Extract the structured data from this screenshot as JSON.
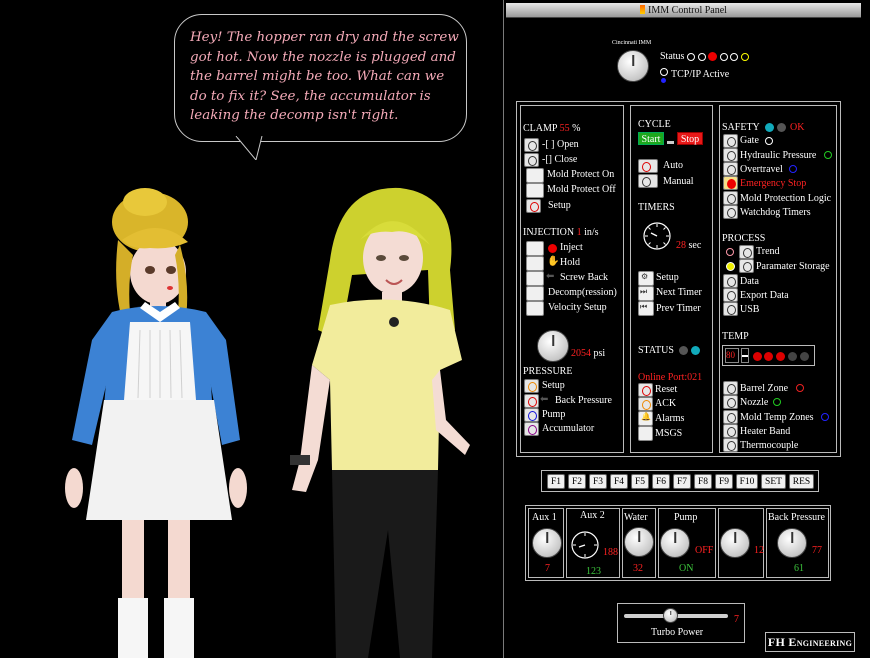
{
  "speech_bubble": {
    "lines": [
      "Hey!  The hopper ran dry and the screw",
      "got hot.  Now the nozzle is plugged and",
      "the barrel might be too.  What can we",
      "do to fix it?  See, the accumulator is",
      "leaking the decomp isn't right."
    ]
  },
  "panel": {
    "title": "IMM Control Panel",
    "brand": "Cincinnati IMM",
    "status_label": "Status",
    "tcpip_label": "TCP/IP Active",
    "clamp": {
      "label": "CLAMP",
      "value": "55",
      "unit": "%",
      "items": [
        "-[ ] Open",
        "-[] Close",
        "Mold Protect On",
        "Mold Protect Off",
        "Setup"
      ]
    },
    "injection": {
      "label": "INJECTION",
      "value": "1",
      "unit": "in/s",
      "items": [
        "Inject",
        "Hold",
        "Screw Back",
        "Decomp(ression)",
        "Velocity Setup"
      ],
      "psi_value": "2054",
      "psi_unit": "psi"
    },
    "pressure": {
      "label": "PRESSURE",
      "items": [
        "Setup",
        "Back Pressure",
        "Pump",
        "Accumulator"
      ]
    },
    "cycle": {
      "label": "CYCLE",
      "start": "Start",
      "stop": "Stop",
      "items": [
        "Auto",
        "Manual"
      ]
    },
    "timers": {
      "label": "TIMERS",
      "value": "28",
      "unit": "sec",
      "items": [
        "Setup",
        "Next Timer",
        "Prev Timer"
      ]
    },
    "status2": {
      "label": "STATUS",
      "online": "Online Port:021",
      "items": [
        "Reset",
        "ACK",
        "Alarms",
        "MSGS"
      ]
    },
    "safety": {
      "label": "SAFETY",
      "ok": "OK",
      "items": [
        "Gate",
        "Hydraulic Pressure",
        "Overtravel",
        "Emergency Stop",
        "Mold Protection Logic",
        "Watchdog Timers"
      ]
    },
    "process": {
      "label": "PROCESS",
      "items": [
        "Trend",
        "Paramater Storage",
        "Data",
        "Export Data",
        "USB"
      ]
    },
    "temp": {
      "label": "TEMP",
      "value": "80",
      "items": [
        "Barrel Zone",
        "Nozzle",
        "Mold Temp Zones",
        "Heater Band",
        "Thermocouple"
      ]
    },
    "fkeys": [
      "F1",
      "F2",
      "F3",
      "F4",
      "F5",
      "F6",
      "F7",
      "F8",
      "F9",
      "F10",
      "SET",
      "RES"
    ],
    "gauges": {
      "aux1": {
        "label": "Aux 1",
        "value": "7"
      },
      "aux2": {
        "label": "Aux 2",
        "side_value": "188",
        "value": "123"
      },
      "water": {
        "label": "Water",
        "value": "32"
      },
      "pump": {
        "label": "Pump",
        "side_value": "OFF",
        "value": "ON"
      },
      "blank": {
        "side_value": "12"
      },
      "back_pressure": {
        "label": "Back Pressure",
        "side_value": "77",
        "value": "61"
      }
    },
    "turbo": {
      "label": "Turbo Power",
      "value": "7",
      "level": 0.45
    },
    "logo": "FH Engineering"
  },
  "colors": {
    "accent_red": "#ff2222",
    "accent_green": "#3cc33c",
    "bubble_text": "#f4aab8"
  }
}
